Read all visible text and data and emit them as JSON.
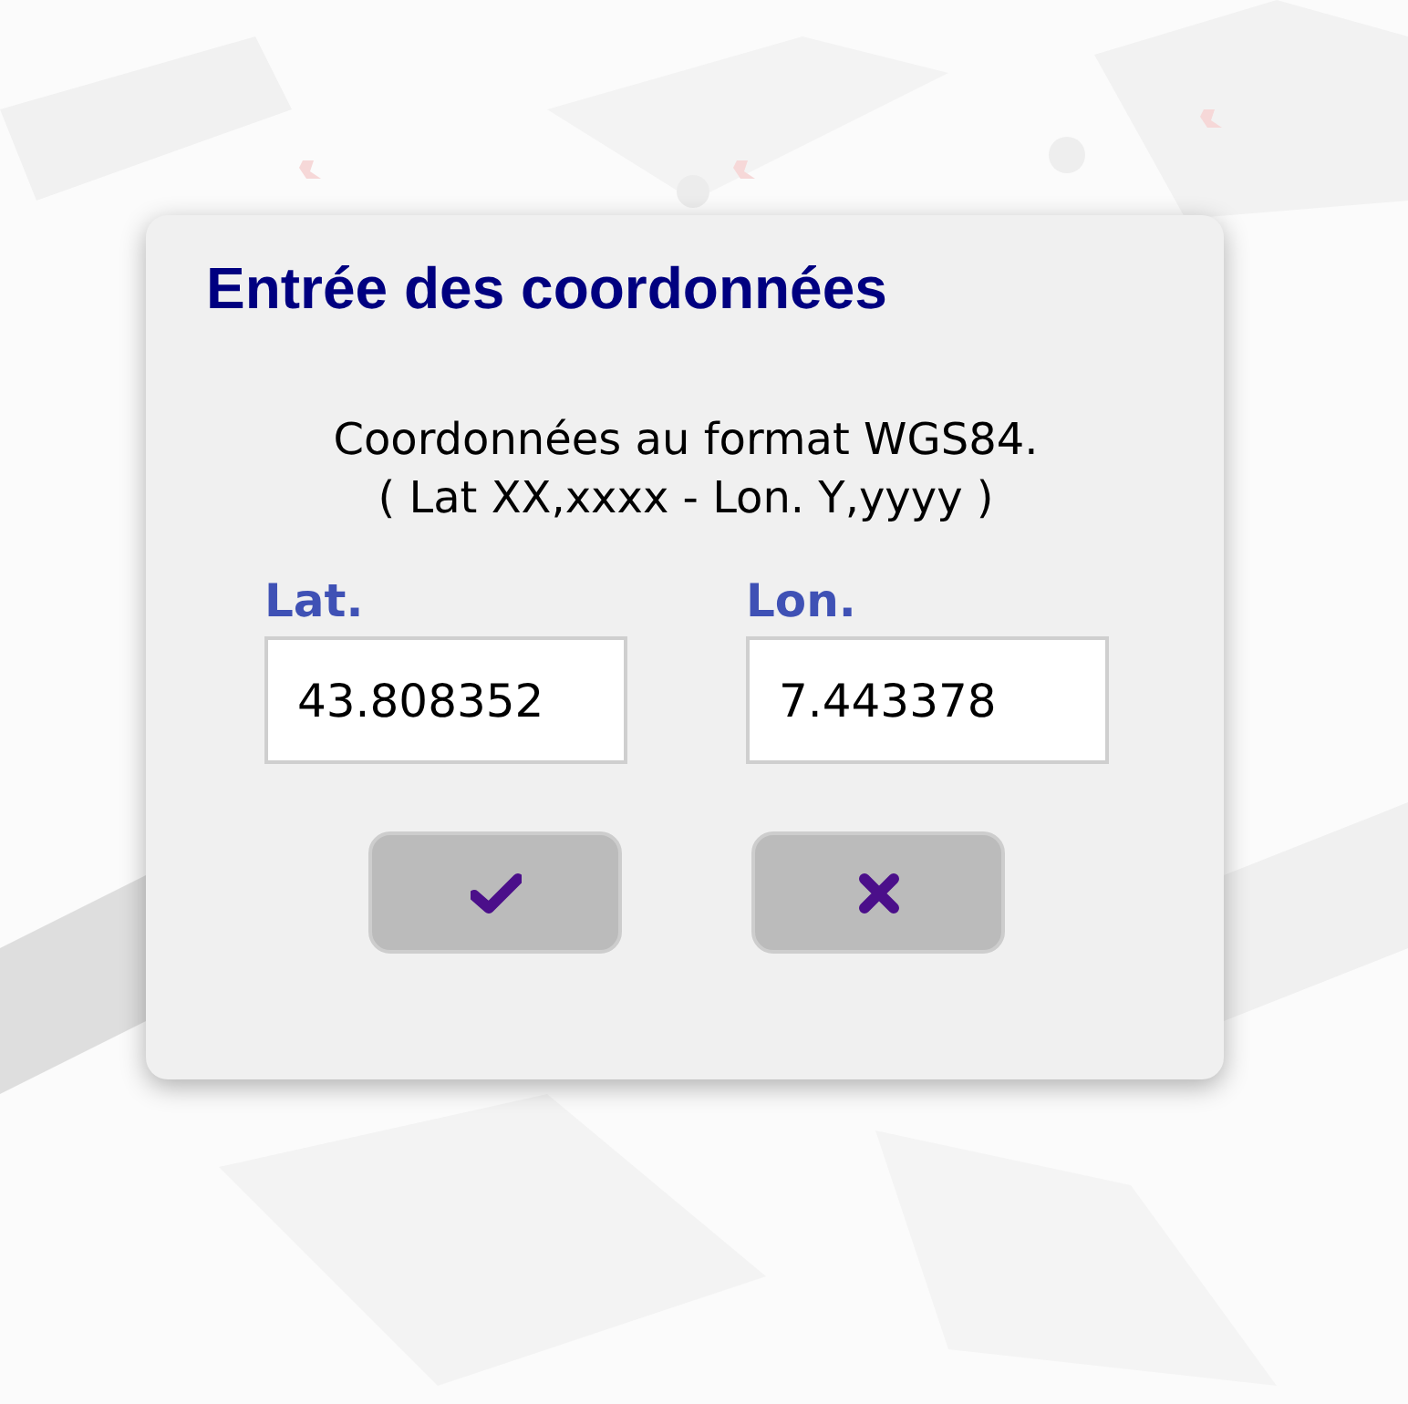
{
  "dialog": {
    "title": "Entrée des coordonnées",
    "instructions": [
      "Coordonnées au format WGS84.",
      "( Lat XX,xxxx - Lon. Y,yyyy )"
    ],
    "fields": [
      {
        "label": "Lat.",
        "value": "43.808352"
      },
      {
        "label": "Lon.",
        "value": "7.443378"
      }
    ],
    "buttons": [
      {
        "kind": "confirm"
      },
      {
        "kind": "cancel"
      }
    ]
  }
}
